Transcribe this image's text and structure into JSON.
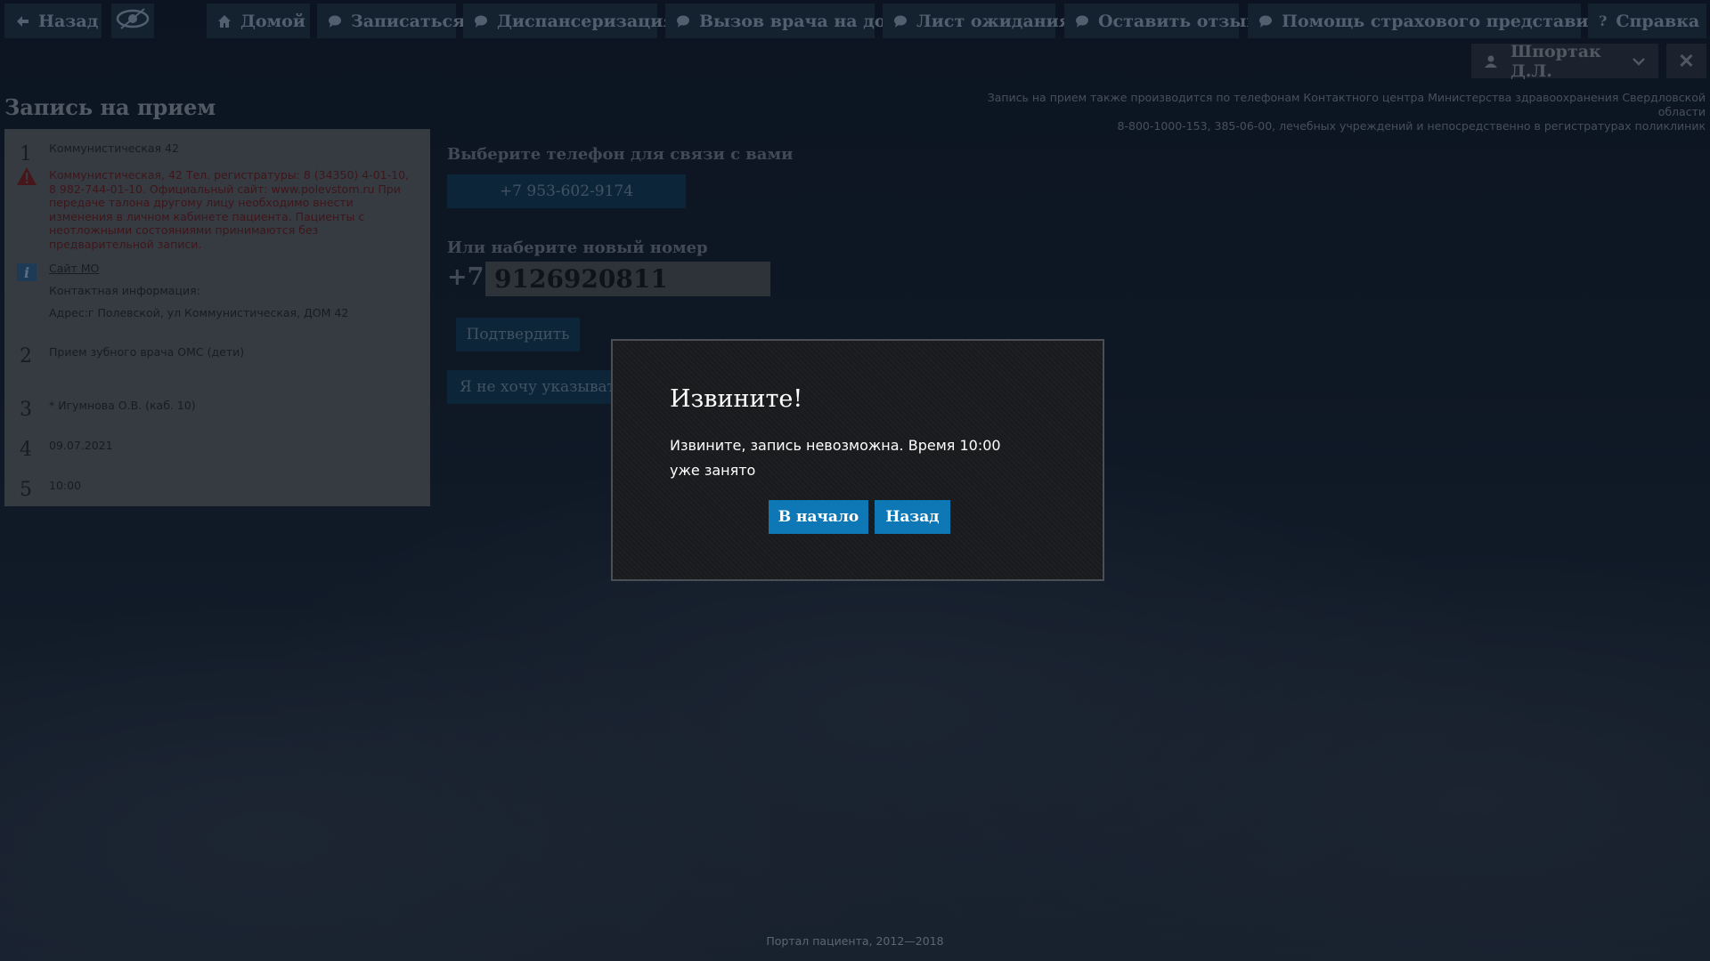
{
  "nav": {
    "back": "Назад",
    "home": "Домой",
    "signup": "Записаться",
    "dispensary": "Диспансеризация",
    "home_doctor": "Вызов врача на дом",
    "waitlist": "Лист ожидания",
    "feedback": "Оставить отзыв",
    "insurance_help": "Помощь страхового представителя",
    "help": "Справка"
  },
  "user": {
    "name": "Шпортак Д.Л."
  },
  "page": {
    "title": "Запись на прием",
    "notice_line1": "Запись на прием также производится по телефонам Контактного центра Министерства здравоохранения Свердловской области",
    "notice_line2": "8-800-1000-153, 385-06-00, лечебных учреждений и непосредственно в регистратурах поликлиник"
  },
  "steps": {
    "s1": {
      "num": "1",
      "title": "Коммунистическая 42",
      "warning": "Коммунистическая, 42 Тел. регистратуры: 8 (34350) 4-01-10, 8 982-744-01-10. Официальный сайт: www.polevstom.ru При передаче талона другому лицу необходимо внести изменения в личном кабинете пациента. Пациенты с неотложными состояниями принимаются без предварительной записи.",
      "site_link": "Сайт МО",
      "contact_label": "Контактная информация:",
      "address": "Адрес:г Полевской, ул Коммунистическая, ДОМ 42"
    },
    "s2": {
      "num": "2",
      "text": "Прием зубного врача ОМС (дети)"
    },
    "s3": {
      "num": "3",
      "text": "* Игумнова О.В. (каб. 10)"
    },
    "s4": {
      "num": "4",
      "text": "09.07.2021"
    },
    "s5": {
      "num": "5",
      "text": "10:00"
    }
  },
  "phone": {
    "choose_label": "Выберите телефон для связи с вами",
    "existing": "+7 953-602-9174",
    "new_label": "Или наберите новый номер",
    "prefix": "+7",
    "input_value": "9126920811",
    "confirm": "Подтвердить",
    "no_phone": "Я не хочу указывать"
  },
  "modal": {
    "title": "Извините!",
    "message": "Извините, запись невозможна. Время 10:00 уже занято",
    "to_start": "В начало",
    "back": "Назад"
  },
  "footer": "Портал пациента, 2012—2018",
  "colors": {
    "modal_button": "#0d78b5",
    "nav_button": "#1e3244",
    "warning_text": "#6a1d1d"
  }
}
